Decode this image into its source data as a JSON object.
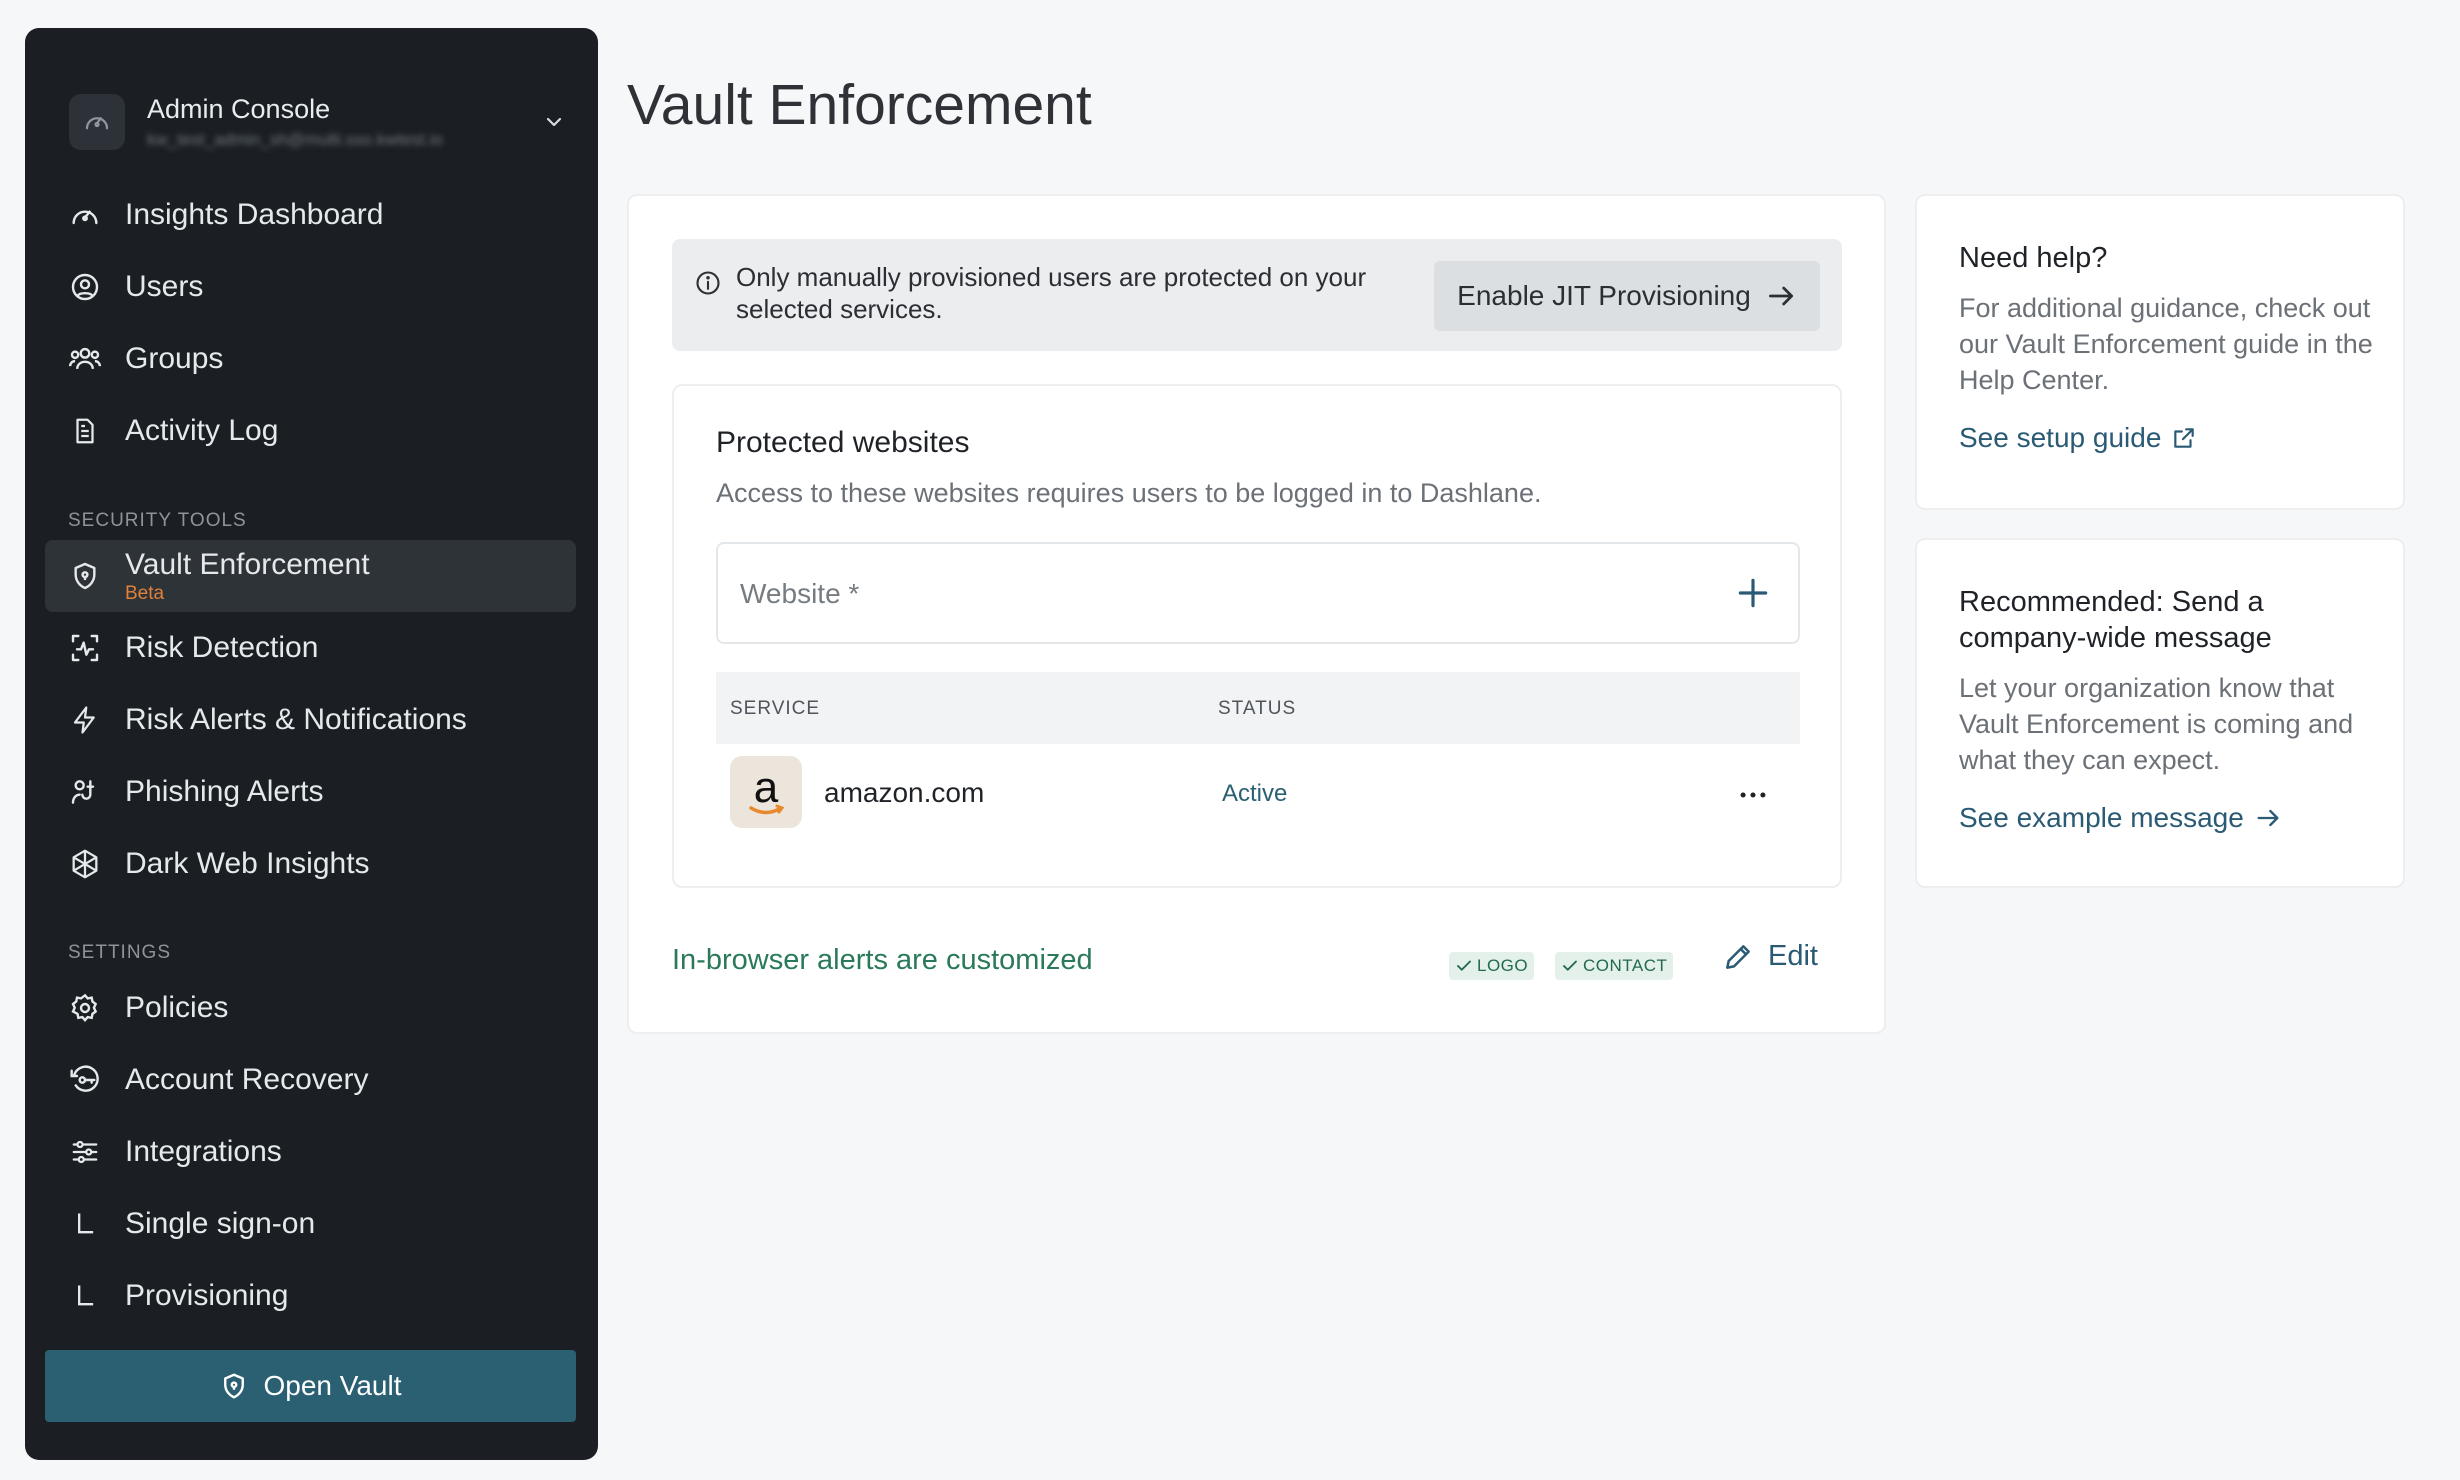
{
  "sidebar": {
    "console_title": "Admin Console",
    "console_subtitle": "kw_test_admin_sh@multi.sso.kwtest.io",
    "nav_top": [
      {
        "label": "Insights Dashboard",
        "icon": "dashboard-icon"
      },
      {
        "label": "Users",
        "icon": "user-circle-icon"
      },
      {
        "label": "Groups",
        "icon": "groups-icon"
      },
      {
        "label": "Activity Log",
        "icon": "document-icon"
      }
    ],
    "security_section_title": "SECURITY TOOLS",
    "security_items": [
      {
        "label": "Vault Enforcement",
        "badge": "Beta",
        "icon": "shield-icon",
        "active": true
      },
      {
        "label": "Risk Detection",
        "icon": "risk-detection-icon"
      },
      {
        "label": "Risk Alerts & Notifications",
        "icon": "lightning-icon"
      },
      {
        "label": "Phishing Alerts",
        "icon": "phishing-icon"
      },
      {
        "label": "Dark Web Insights",
        "icon": "dark-web-icon"
      }
    ],
    "settings_section_title": "SETTINGS",
    "settings_items": [
      {
        "label": "Policies",
        "icon": "gear-icon"
      },
      {
        "label": "Account Recovery",
        "icon": "key-recovery-icon"
      },
      {
        "label": "Integrations",
        "icon": "sliders-icon"
      },
      {
        "label": "Single sign-on",
        "icon": "sub-item-icon"
      },
      {
        "label": "Provisioning",
        "icon": "sub-item-icon"
      }
    ],
    "open_vault_label": "Open Vault"
  },
  "main": {
    "page_title": "Vault Enforcement",
    "banner": {
      "text": "Only manually provisioned users are protected on your selected services.",
      "button_label": "Enable JIT Provisioning"
    },
    "protected": {
      "title": "Protected websites",
      "description": "Access to these websites requires users to be logged in to Dashlane.",
      "input_placeholder": "Website *",
      "columns": [
        "SERVICE",
        "STATUS"
      ],
      "rows": [
        {
          "logo_letter": "a",
          "service": "amazon.com",
          "status": "Active"
        }
      ]
    },
    "alerts": {
      "text": "In-browser alerts are customized",
      "badges": [
        "LOGO",
        "CONTACT"
      ],
      "edit_label": "Edit"
    }
  },
  "help_card": {
    "title": "Need help?",
    "text": "For additional guidance, check out our Vault Enforcement guide in the Help Center.",
    "link": "See setup guide"
  },
  "recommend_card": {
    "title": "Recommended: Send a company-wide message",
    "text": "Let your organization know that Vault Enforcement is coming and what they can expect.",
    "link": "See example message"
  },
  "colors": {
    "sidebar_bg": "#1b1f23",
    "accent_teal": "#2a6072",
    "beta_orange": "#e0813a",
    "success_green": "#2a7a5a"
  }
}
